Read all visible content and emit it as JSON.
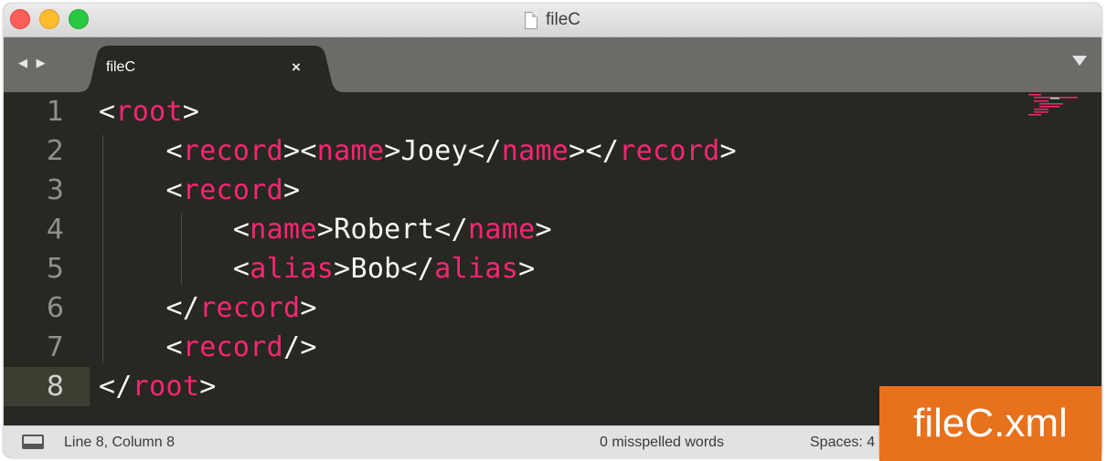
{
  "window": {
    "title": "fileC"
  },
  "tabs": [
    {
      "label": "fileC",
      "close": "×"
    }
  ],
  "nav": {
    "arrows": "◀ ▶"
  },
  "lines": [
    {
      "num": "1",
      "indent": "",
      "parts": [
        [
          "p",
          "<"
        ],
        [
          "t",
          "root"
        ],
        [
          "p",
          ">"
        ]
      ]
    },
    {
      "num": "2",
      "indent": "    ",
      "parts": [
        [
          "p",
          "<"
        ],
        [
          "t",
          "record"
        ],
        [
          "p",
          "><"
        ],
        [
          "t",
          "name"
        ],
        [
          "p",
          ">Joey</"
        ],
        [
          "t",
          "name"
        ],
        [
          "p",
          "></"
        ],
        [
          "t",
          "record"
        ],
        [
          "p",
          ">"
        ]
      ]
    },
    {
      "num": "3",
      "indent": "    ",
      "parts": [
        [
          "p",
          "<"
        ],
        [
          "t",
          "record"
        ],
        [
          "p",
          ">"
        ]
      ]
    },
    {
      "num": "4",
      "indent": "        ",
      "parts": [
        [
          "p",
          "<"
        ],
        [
          "t",
          "name"
        ],
        [
          "p",
          ">Robert</"
        ],
        [
          "t",
          "name"
        ],
        [
          "p",
          ">"
        ]
      ]
    },
    {
      "num": "5",
      "indent": "        ",
      "parts": [
        [
          "p",
          "<"
        ],
        [
          "t",
          "alias"
        ],
        [
          "p",
          ">Bob</"
        ],
        [
          "t",
          "alias"
        ],
        [
          "p",
          ">"
        ]
      ]
    },
    {
      "num": "6",
      "indent": "    ",
      "parts": [
        [
          "p",
          "</"
        ],
        [
          "t",
          "record"
        ],
        [
          "p",
          ">"
        ]
      ]
    },
    {
      "num": "7",
      "indent": "    ",
      "parts": [
        [
          "p",
          "<"
        ],
        [
          "t",
          "record"
        ],
        [
          "p",
          "/>"
        ]
      ]
    },
    {
      "num": "8",
      "indent": "",
      "parts": [
        [
          "p",
          "</"
        ],
        [
          "t",
          "root"
        ],
        [
          "p",
          ">"
        ]
      ]
    }
  ],
  "active_line": 8,
  "status": {
    "position": "Line 8, Column 8",
    "spelling": "0 misspelled words",
    "spaces": "Spaces: 4"
  },
  "badge": {
    "label": "fileC.xml",
    "color": "#e8711c"
  },
  "colors": {
    "tag": "#f92672",
    "text": "#f8f8f2",
    "background": "#272822"
  }
}
